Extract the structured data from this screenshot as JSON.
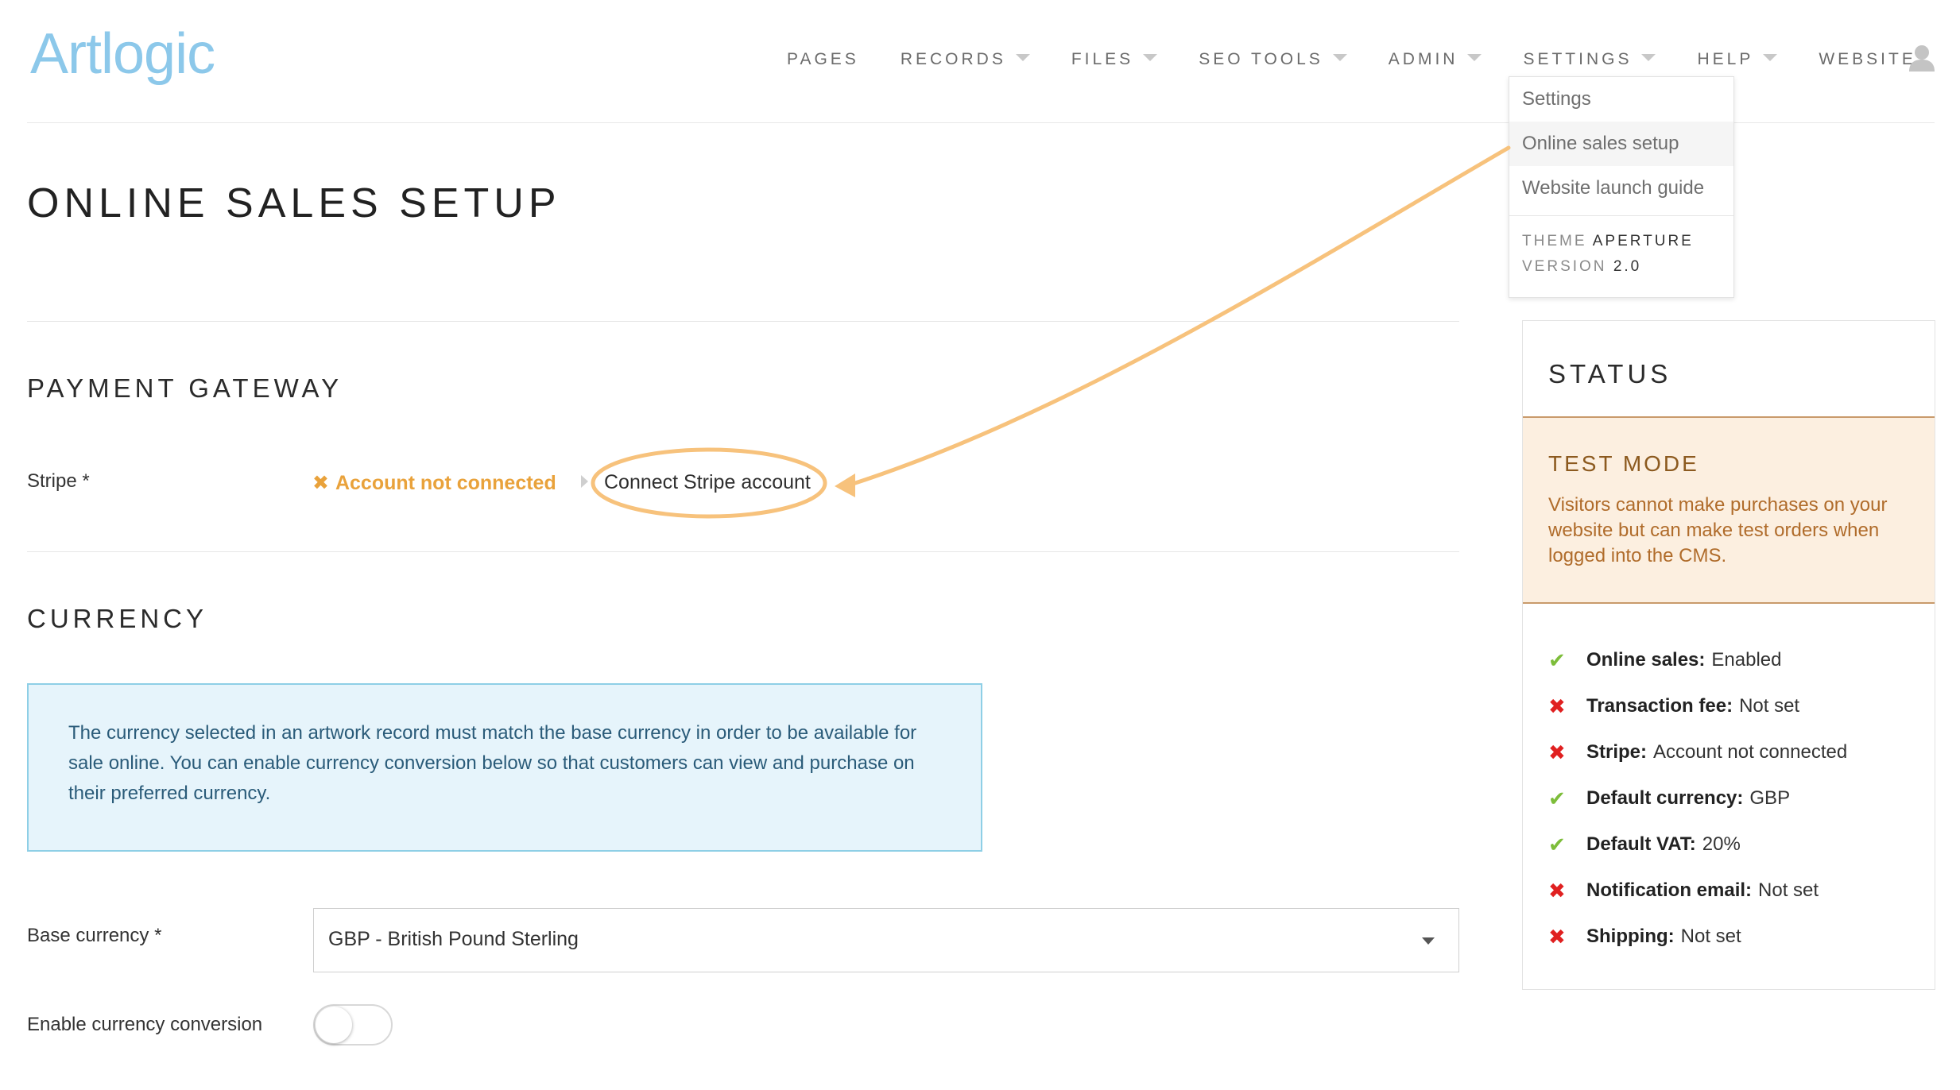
{
  "app": {
    "logo": "Artlogic"
  },
  "nav": {
    "items": [
      {
        "label": "PAGES",
        "has_caret": false
      },
      {
        "label": "RECORDS",
        "has_caret": true
      },
      {
        "label": "FILES",
        "has_caret": true
      },
      {
        "label": "SEO TOOLS",
        "has_caret": true
      },
      {
        "label": "ADMIN",
        "has_caret": true
      },
      {
        "label": "SETTINGS",
        "has_caret": true
      },
      {
        "label": "HELP",
        "has_caret": true
      },
      {
        "label": "WEBSITE",
        "has_caret": false
      }
    ],
    "user_icon": "user-icon"
  },
  "settings_dropdown": {
    "items": [
      {
        "label": "Settings",
        "active": false
      },
      {
        "label": "Online sales setup",
        "active": true
      },
      {
        "label": "Website launch guide",
        "active": false
      }
    ],
    "theme_label": "THEME",
    "theme_value": "APERTURE",
    "version_label": "VERSION",
    "version_value": "2.0"
  },
  "page": {
    "title": "ONLINE SALES SETUP",
    "payment_gateway": {
      "heading": "PAYMENT GATEWAY",
      "stripe_label": "Stripe *",
      "status_icon": "cross-icon",
      "status_text": "Account not connected",
      "connect_link": "Connect Stripe account"
    },
    "currency": {
      "heading": "CURRENCY",
      "info": "The currency selected in an artwork record must match the base currency in order to be available for sale online. You can enable currency conversion below so that customers can view and purchase on their preferred currency.",
      "base_label": "Base currency *",
      "base_value": "GBP - British Pound Sterling",
      "conversion_label": "Enable currency conversion",
      "conversion_enabled": false
    }
  },
  "status_panel": {
    "title": "STATUS",
    "test_mode": {
      "title": "TEST MODE",
      "text": "Visitors cannot make purchases on your website but can make test orders when logged into the CMS."
    },
    "items": [
      {
        "ok": true,
        "icon": "check-icon",
        "label": "Online sales:",
        "value": "Enabled"
      },
      {
        "ok": false,
        "icon": "cross-icon",
        "label": "Transaction fee:",
        "value": "Not set"
      },
      {
        "ok": false,
        "icon": "cross-icon",
        "label": "Stripe:",
        "value": "Account not connected"
      },
      {
        "ok": true,
        "icon": "check-icon",
        "label": "Default currency:",
        "value": "GBP"
      },
      {
        "ok": true,
        "icon": "check-icon",
        "label": "Default VAT:",
        "value": "20%"
      },
      {
        "ok": false,
        "icon": "cross-icon",
        "label": "Notification email:",
        "value": "Not set"
      },
      {
        "ok": false,
        "icon": "cross-icon",
        "label": "Shipping:",
        "value": "Not set"
      }
    ]
  },
  "colors": {
    "accent_logo": "#8cc8ea",
    "warning": "#e9a23b",
    "annotation": "#f7c27c",
    "ok": "#7dbd3a",
    "error": "#e02020",
    "test_mode_bg": "#fcefe0",
    "info_bg": "#e6f4fb"
  }
}
